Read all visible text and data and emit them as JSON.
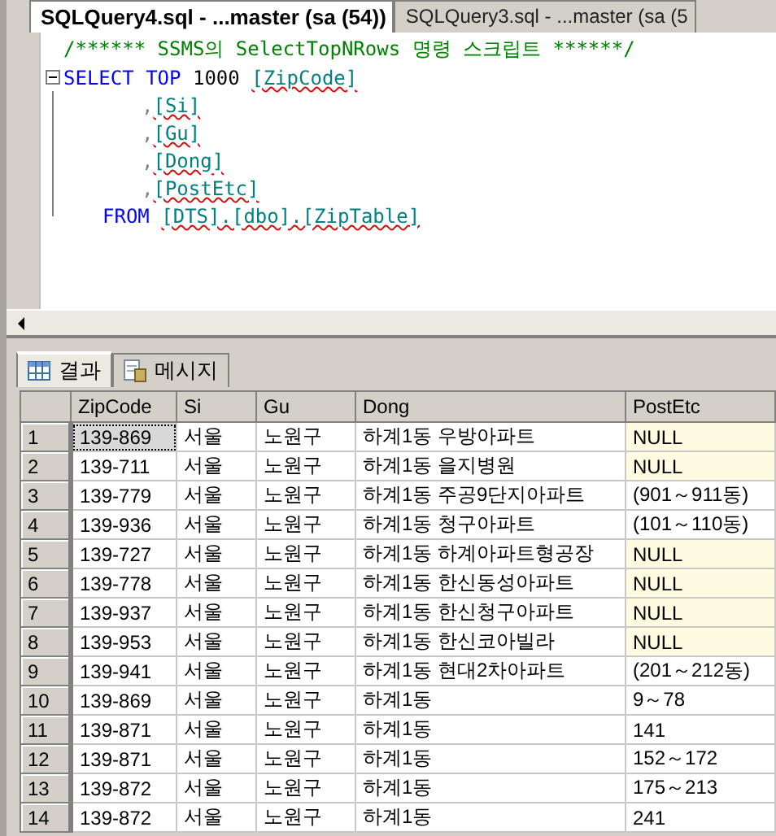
{
  "doc_tabs": [
    {
      "label": "SQLQuery4.sql - ...master (sa (54))",
      "selected": true
    },
    {
      "label": "SQLQuery3.sql - ...master (sa (5",
      "selected": false
    }
  ],
  "editor": {
    "lines": [
      {
        "kind": "comment",
        "tokens": [
          {
            "kind": "comment",
            "text": "/****** SSMS의 SelectTopNRows 명령 스크립트 ******/"
          }
        ]
      },
      {
        "kind": "select",
        "tokens": [
          {
            "kind": "keyword",
            "text": "SELECT"
          },
          {
            "kind": "keyword",
            "text": "TOP"
          },
          {
            "kind": "number",
            "text": "1000"
          },
          {
            "kind": "ident",
            "text": "[ZipCode]"
          }
        ]
      },
      {
        "kind": "column",
        "tokens": [
          {
            "kind": "punct",
            "text": ","
          },
          {
            "kind": "ident",
            "text": "[Si]"
          }
        ]
      },
      {
        "kind": "column",
        "tokens": [
          {
            "kind": "punct",
            "text": ","
          },
          {
            "kind": "ident",
            "text": "[Gu]"
          }
        ]
      },
      {
        "kind": "column",
        "tokens": [
          {
            "kind": "punct",
            "text": ","
          },
          {
            "kind": "ident",
            "text": "[Dong]"
          }
        ]
      },
      {
        "kind": "column",
        "tokens": [
          {
            "kind": "punct",
            "text": ","
          },
          {
            "kind": "ident",
            "text": "[PostEtc]"
          }
        ]
      },
      {
        "kind": "from",
        "tokens": [
          {
            "kind": "keyword",
            "text": "FROM"
          },
          {
            "kind": "ident",
            "text": "[DTS].[dbo].[ZipTable]"
          }
        ]
      }
    ]
  },
  "result_tabs": [
    {
      "label": "결과",
      "selected": true
    },
    {
      "label": "메시지",
      "selected": false
    }
  ],
  "table": {
    "columns": [
      "ZipCode",
      "Si",
      "Gu",
      "Dong",
      "PostEtc"
    ],
    "rows": [
      {
        "num": "1",
        "selected": true,
        "cells": [
          "139-869",
          "서울",
          "노원구",
          "하계1동 우방아파트"
        ],
        "post_etc": {
          "text": "NULL",
          "null": true
        }
      },
      {
        "num": "2",
        "selected": false,
        "cells": [
          "139-711",
          "서울",
          "노원구",
          "하계1동 을지병원"
        ],
        "post_etc": {
          "text": "NULL",
          "null": true
        }
      },
      {
        "num": "3",
        "selected": false,
        "cells": [
          "139-779",
          "서울",
          "노원구",
          "하계1동 주공9단지아파트"
        ],
        "post_etc": {
          "text": "(901～911동)",
          "null": false
        }
      },
      {
        "num": "4",
        "selected": false,
        "cells": [
          "139-936",
          "서울",
          "노원구",
          "하계1동 청구아파트"
        ],
        "post_etc": {
          "text": "(101～110동)",
          "null": false
        }
      },
      {
        "num": "5",
        "selected": false,
        "cells": [
          "139-727",
          "서울",
          "노원구",
          "하계1동 하계아파트형공장"
        ],
        "post_etc": {
          "text": "NULL",
          "null": true
        }
      },
      {
        "num": "6",
        "selected": false,
        "cells": [
          "139-778",
          "서울",
          "노원구",
          "하계1동 한신동성아파트"
        ],
        "post_etc": {
          "text": "NULL",
          "null": true
        }
      },
      {
        "num": "7",
        "selected": false,
        "cells": [
          "139-937",
          "서울",
          "노원구",
          "하계1동 한신청구아파트"
        ],
        "post_etc": {
          "text": "NULL",
          "null": true
        }
      },
      {
        "num": "8",
        "selected": false,
        "cells": [
          "139-953",
          "서울",
          "노원구",
          "하계1동 한신코아빌라"
        ],
        "post_etc": {
          "text": "NULL",
          "null": true
        }
      },
      {
        "num": "9",
        "selected": false,
        "cells": [
          "139-941",
          "서울",
          "노원구",
          "하계1동 현대2차아파트"
        ],
        "post_etc": {
          "text": "(201～212동)",
          "null": false
        }
      },
      {
        "num": "10",
        "selected": false,
        "cells": [
          "139-869",
          "서울",
          "노원구",
          "하계1동"
        ],
        "post_etc": {
          "text": "9～78",
          "null": false
        }
      },
      {
        "num": "11",
        "selected": false,
        "cells": [
          "139-871",
          "서울",
          "노원구",
          "하계1동"
        ],
        "post_etc": {
          "text": "141",
          "null": false
        }
      },
      {
        "num": "12",
        "selected": false,
        "cells": [
          "139-871",
          "서울",
          "노원구",
          "하계1동"
        ],
        "post_etc": {
          "text": "152～172",
          "null": false
        }
      },
      {
        "num": "13",
        "selected": false,
        "cells": [
          "139-872",
          "서울",
          "노원구",
          "하계1동"
        ],
        "post_etc": {
          "text": "175～213",
          "null": false
        }
      },
      {
        "num": "14",
        "selected": false,
        "cells": [
          "139-872",
          "서울",
          "노원구",
          "하계1동"
        ],
        "post_etc": {
          "text": "241",
          "null": false
        }
      }
    ]
  }
}
